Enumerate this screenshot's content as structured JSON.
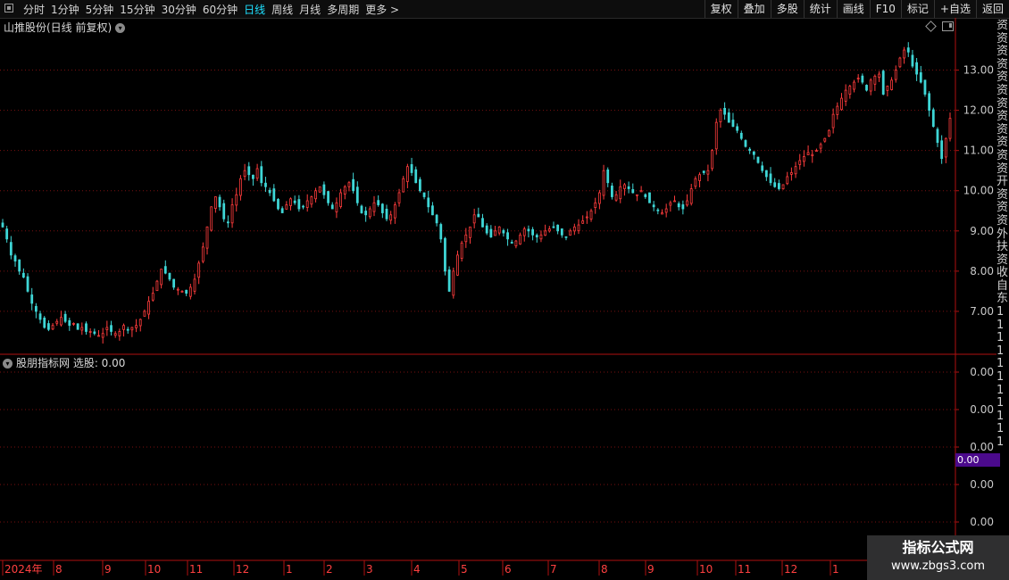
{
  "toolbar": {
    "periods": [
      "分时",
      "1分钟",
      "5分钟",
      "15分钟",
      "30分钟",
      "60分钟",
      "日线",
      "周线",
      "月线",
      "多周期",
      "更多 >"
    ],
    "active_period": "日线",
    "right_buttons": [
      "复权",
      "叠加",
      "多股",
      "统计",
      "画线",
      "F10",
      "标记",
      "+自选",
      "返回"
    ]
  },
  "title": "山推股份(日线 前复权)",
  "indicator": {
    "title": "股朋指标网 选股: 0.00",
    "value_box": "0.00",
    "axis_labels": [
      "0.00",
      "0.00",
      "0.00",
      "0.00",
      "0.00"
    ]
  },
  "right_strip_text": "资资资资资资资资资资资资开资资资外扶资收自东11111111111",
  "watermark": {
    "line1": "指标公式网",
    "line2": "www.zbgs3.com"
  },
  "colors": {
    "up": "#ff3c3c",
    "down": "#3fd6d6",
    "grid": "#7a1010",
    "axis": "#b01010"
  },
  "chart_data": {
    "type": "candlestick",
    "title": "",
    "y_ticks": [
      7.0,
      8.0,
      9.0,
      10.0,
      11.0,
      12.0,
      13.0
    ],
    "ylim": [
      6.0,
      13.9
    ],
    "x_labels": [
      "2024年",
      "8",
      "9",
      "10",
      "11",
      "12",
      "1",
      "2",
      "3",
      "4",
      "5",
      "6",
      "7",
      "8",
      "9",
      "10",
      "11",
      "12",
      "1"
    ],
    "closes": [
      9.1,
      8.8,
      8.4,
      8.25,
      8.0,
      7.85,
      7.5,
      7.2,
      7.0,
      6.8,
      6.6,
      6.55,
      6.65,
      6.75,
      6.85,
      6.75,
      6.65,
      6.7,
      6.55,
      6.6,
      6.5,
      6.5,
      6.45,
      6.4,
      6.45,
      6.6,
      6.5,
      6.45,
      6.5,
      6.65,
      6.55,
      6.6,
      6.65,
      6.8,
      7.0,
      7.25,
      7.45,
      7.75,
      8.05,
      7.95,
      7.8,
      7.6,
      7.55,
      7.5,
      7.45,
      7.6,
      7.8,
      8.2,
      8.6,
      9.1,
      9.6,
      9.85,
      9.6,
      9.3,
      9.2,
      9.65,
      9.9,
      10.3,
      10.5,
      10.4,
      10.3,
      10.55,
      10.2,
      10.1,
      9.95,
      9.75,
      9.55,
      9.45,
      9.65,
      9.8,
      9.7,
      9.55,
      9.6,
      9.75,
      9.85,
      10.0,
      10.1,
      9.9,
      9.7,
      9.55,
      9.7,
      9.95,
      10.1,
      10.2,
      10.0,
      9.7,
      9.45,
      9.4,
      9.55,
      9.7,
      9.65,
      9.45,
      9.3,
      9.4,
      9.65,
      9.95,
      10.3,
      10.6,
      10.45,
      10.2,
      10.0,
      9.85,
      9.6,
      9.4,
      9.2,
      8.8,
      8.0,
      7.5,
      8.0,
      8.4,
      8.7,
      8.9,
      9.1,
      9.4,
      9.35,
      9.1,
      8.95,
      8.85,
      9.0,
      9.1,
      8.95,
      8.8,
      8.7,
      8.75,
      8.9,
      9.05,
      9.0,
      8.9,
      8.85,
      8.9,
      9.0,
      9.05,
      9.1,
      9.0,
      8.9,
      8.85,
      9.0,
      9.1,
      9.15,
      9.25,
      9.35,
      9.5,
      9.7,
      9.95,
      10.5,
      10.2,
      9.85,
      9.9,
      10.1,
      10.15,
      10.05,
      9.95,
      9.9,
      10.0,
      9.85,
      9.7,
      9.6,
      9.5,
      9.45,
      9.55,
      9.7,
      9.75,
      9.6,
      9.55,
      9.75,
      10.05,
      10.3,
      10.4,
      10.45,
      10.5,
      11.0,
      11.7,
      12.0,
      11.9,
      11.7,
      11.6,
      11.5,
      11.3,
      11.1,
      11.0,
      10.9,
      10.7,
      10.5,
      10.35,
      10.2,
      10.1,
      10.05,
      10.15,
      10.35,
      10.45,
      10.6,
      10.75,
      10.85,
      10.95,
      10.9,
      11.0,
      11.15,
      11.3,
      11.5,
      11.9,
      12.1,
      12.3,
      12.5,
      12.6,
      12.7,
      12.8,
      12.7,
      12.5,
      12.75,
      12.85,
      12.9,
      12.4,
      12.6,
      12.75,
      13.0,
      13.3,
      13.5,
      13.45,
      13.1,
      12.9,
      12.7,
      12.4,
      12.0,
      11.6,
      11.2,
      10.8,
      11.3,
      11.8
    ]
  }
}
